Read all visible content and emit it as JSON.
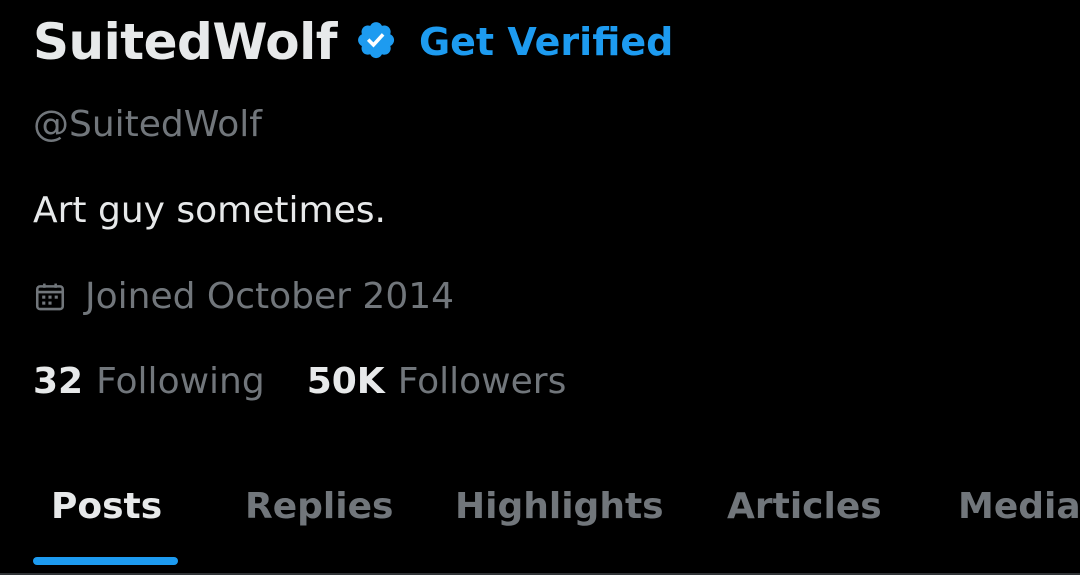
{
  "profile": {
    "display_name": "SuitedWolf",
    "get_verified_label": "Get Verified",
    "handle": "@SuitedWolf",
    "bio": "Art guy sometimes.",
    "joined": "Joined October 2014",
    "verified_icon": "verified-badge-icon",
    "calendar_icon": "calendar-icon"
  },
  "stats": {
    "following_count": "32",
    "following_label": "Following",
    "followers_count": "50K",
    "followers_label": "Followers"
  },
  "tabs": [
    {
      "label": "Posts",
      "active": true
    },
    {
      "label": "Replies",
      "active": false
    },
    {
      "label": "Highlights",
      "active": false
    },
    {
      "label": "Articles",
      "active": false
    },
    {
      "label": "Media",
      "active": false
    }
  ],
  "colors": {
    "background": "#000000",
    "primary_text": "#e7e9ea",
    "secondary_text": "#71767b",
    "accent": "#1d9bf0",
    "divider": "#2f3336"
  }
}
